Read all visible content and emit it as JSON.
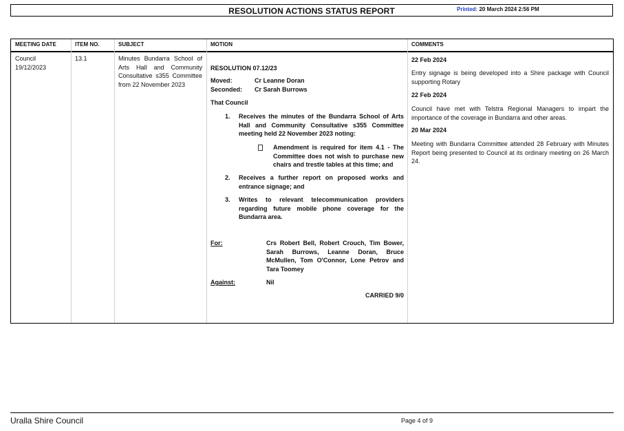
{
  "report": {
    "title": "RESOLUTION ACTIONS STATUS REPORT",
    "printed_label": "Printed:",
    "printed_value": "20 March 2024 2:56 PM"
  },
  "table": {
    "headers": {
      "meeting_date": "MEETING DATE",
      "item_no": "ITEM NO.",
      "subject": "SUBJECT",
      "motion": "MOTION",
      "comments": "COMMENTS"
    },
    "row": {
      "meeting_type": "Council",
      "meeting_date": "19/12/2023",
      "item_no": "13.1",
      "subject": "Minutes Bundarra School of Arts Hall and Community Consultative s355 Committee from 22 November 2023",
      "motion": {
        "resolution": "RESOLUTION 07.12/23",
        "moved_label": "Moved:",
        "moved_value": "Cr Leanne Doran",
        "seconded_label": "Seconded:",
        "seconded_value": "Cr Sarah Burrows",
        "that_council": "That Council",
        "items": [
          {
            "num": "1.",
            "text": "Receives the minutes of the Bundarra School of Arts Hall and Community Consultative s355 Committee meeting held 22 November 2023 noting:"
          },
          {
            "num": "2.",
            "text": "Receives a further report on proposed works and entrance signage; and"
          },
          {
            "num": "3.",
            "text": "Writes to relevant telecommunication providers regarding future mobile phone coverage for the Bundarra area."
          }
        ],
        "subitem": "Amendment is required for item 4.1 - The Committee does not wish to purchase new chairs and trestle tables at this time; and",
        "for_label": "For:",
        "for_value": "Crs Robert Bell, Robert Crouch, Tim Bower, Sarah Burrows, Leanne Doran, Bruce McMullen, Tom O'Connor, Lone Petrov and Tara Toomey",
        "against_label": "Against:",
        "against_value": "Nil",
        "result": "CARRIED 9/0"
      },
      "comments": [
        {
          "date": "22 Feb 2024",
          "text": "Entry signage is being developed into a Shire package with Council supporting Rotary"
        },
        {
          "date": "22 Feb 2024",
          "text": "Council have met with Telstra Regional Managers to impart the importance of the coverage in Bundarra and other areas."
        },
        {
          "date": "20 Mar 2024",
          "text": "Meeting with Bundarra Committee attended 28 February with Minutes Report being presented to Council at its ordinary meeting on 26 March 24."
        }
      ]
    }
  },
  "footer": {
    "organisation": "Uralla Shire Council",
    "page": "Page 4 of 9"
  },
  "colors": {
    "printed_label": "#1f3fbf"
  }
}
